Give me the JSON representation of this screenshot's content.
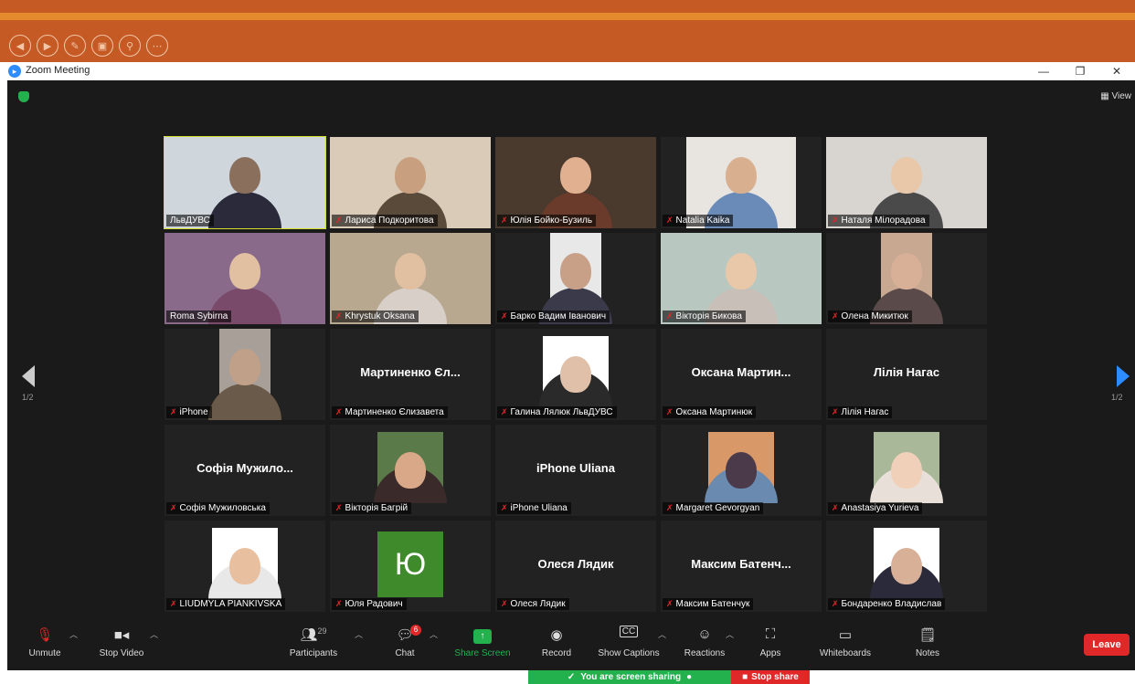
{
  "window": {
    "title": "Zoom Meeting",
    "controls": [
      "—",
      "❐",
      "✕"
    ]
  },
  "top_controls": [
    "◀",
    "▶",
    "✎",
    "▣",
    "⚲",
    "⋯"
  ],
  "header": {
    "view_label": "View"
  },
  "pagination": {
    "left": "1/2",
    "right": "1/2"
  },
  "participants": [
    {
      "name": "ЛьвДУВС",
      "video": true,
      "active": true,
      "muted": false,
      "bg": "#cfd6dc",
      "skin": "#8a6f5c",
      "shirt": "#2a2a3a",
      "width": "full"
    },
    {
      "name": "Лариса Подкоритова",
      "video": true,
      "muted": true,
      "bg": "#d9cbb8",
      "skin": "#c8a080",
      "shirt": "#5a4a3a",
      "width": "full"
    },
    {
      "name": "Юлія Бойко-Бузиль",
      "video": true,
      "muted": true,
      "bg": "#4a3a2e",
      "skin": "#e0b090",
      "shirt": "#6a3a2a",
      "width": "full"
    },
    {
      "name": "Natalia Kaika",
      "video": true,
      "muted": true,
      "bg": "#e8e4e0",
      "skin": "#d8b090",
      "shirt": "#6a8ab8",
      "width": "mid"
    },
    {
      "name": "Наталя Мілорадова",
      "video": true,
      "muted": true,
      "bg": "#d8d4d0",
      "skin": "#e8c8a8",
      "shirt": "#4a4a4a",
      "width": "full"
    },
    {
      "name": "Roma Sybirna",
      "video": true,
      "muted": false,
      "bg": "#8a6a8a",
      "skin": "#e0c0a0",
      "shirt": "#7a4a6a",
      "width": "full"
    },
    {
      "name": "Khrystuk Oksana",
      "video": true,
      "muted": true,
      "bg": "#b8a890",
      "skin": "#e0c0a0",
      "shirt": "#d8d0c8",
      "width": "full"
    },
    {
      "name": "Барко Вадим Іванович",
      "video": true,
      "muted": true,
      "bg": "#e8e8e8",
      "skin": "#c8a088",
      "shirt": "#3a3a4a",
      "width": "narrow"
    },
    {
      "name": "Вікторія Бикова",
      "video": true,
      "muted": true,
      "bg": "#b8c8c0",
      "skin": "#e8c8a8",
      "shirt": "#c8c0b8",
      "width": "full"
    },
    {
      "name": "Олена Микитюк",
      "video": true,
      "muted": true,
      "bg": "#c8a890",
      "skin": "#d8b098",
      "shirt": "#5a4a4a",
      "width": "narrow"
    },
    {
      "name": "iPhone",
      "video": true,
      "muted": true,
      "bg": "#a8a098",
      "skin": "#c0a088",
      "shirt": "#6a5a4a",
      "width": "narrow"
    },
    {
      "name": "Мартиненко Єлизавета",
      "video": false,
      "muted": true,
      "display": "Мартиненко Єл..."
    },
    {
      "name": "Галина Лялюк ЛьвДУВС",
      "video": true,
      "muted": true,
      "bg": "#ffffff",
      "skin": "#e0c0a8",
      "shirt": "#2a2a2a",
      "width": "pic"
    },
    {
      "name": "Оксана Мартинюк",
      "video": false,
      "muted": true,
      "display": "Оксана Мартин..."
    },
    {
      "name": "Лілія Нагас",
      "video": false,
      "muted": true,
      "display": "Лілія Нагас"
    },
    {
      "name": "Софія Мужиловська",
      "video": false,
      "muted": true,
      "display": "Софія Мужило..."
    },
    {
      "name": "Вікторія Багрій",
      "video": true,
      "muted": true,
      "bg": "#5a7a4a",
      "skin": "#d8a888",
      "shirt": "#3a2a2a",
      "width": "pic"
    },
    {
      "name": "iPhone Uliana",
      "video": false,
      "muted": true,
      "display": "iPhone Uliana"
    },
    {
      "name": "Margaret Gevorgyan",
      "video": true,
      "muted": true,
      "bg": "#d89868",
      "skin": "#4a3a4a",
      "shirt": "#6a8ab0",
      "width": "pic"
    },
    {
      "name": "Anastasiya Yurieva",
      "video": true,
      "muted": true,
      "bg": "#a8b898",
      "skin": "#f0d0b8",
      "shirt": "#e8e0d8",
      "width": "pic"
    },
    {
      "name": "LIUDMYLA PIANKIVSKA",
      "video": true,
      "muted": true,
      "bg": "#ffffff",
      "skin": "#e8c0a0",
      "shirt": "#e8e8e8",
      "width": "pic"
    },
    {
      "name": "Юля Радович",
      "video": false,
      "muted": true,
      "avatar": "Ю"
    },
    {
      "name": "Олеся Лядик",
      "video": false,
      "muted": true,
      "display": "Олеся Лядик"
    },
    {
      "name": "Максим Батенчук",
      "video": false,
      "muted": true,
      "display": "Максим Батенч..."
    },
    {
      "name": "Бондаренко Владислав",
      "video": true,
      "muted": true,
      "bg": "#ffffff",
      "skin": "#d8b098",
      "shirt": "#2a2a3a",
      "width": "pic"
    }
  ],
  "toolbar": {
    "unmute": "Unmute",
    "stop_video": "Stop Video",
    "participants": "Participants",
    "participants_count": "29",
    "chat": "Chat",
    "chat_badge": "6",
    "share_screen": "Share Screen",
    "record": "Record",
    "show_captions": "Show Captions",
    "reactions": "Reactions",
    "apps": "Apps",
    "whiteboards": "Whiteboards",
    "notes": "Notes",
    "leave": "Leave"
  },
  "share_bar": {
    "status": "You are screen sharing",
    "stop": "Stop share"
  }
}
